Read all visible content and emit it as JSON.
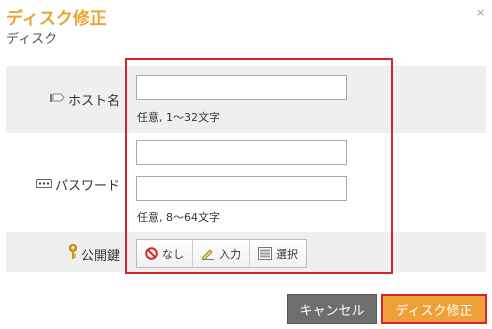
{
  "dialog": {
    "title": "ディスク修正",
    "subtitle": "ディスク",
    "close_symbol": "×"
  },
  "form": {
    "host": {
      "label": "ホスト名",
      "icon": "tag-icon",
      "value": "",
      "hint": "任意, 1〜32文字"
    },
    "password": {
      "label": "パスワード",
      "icon": "password-icon",
      "value": "",
      "confirm_value": "",
      "hint": "任意, 8〜64文字"
    },
    "public_key": {
      "label": "公開鍵",
      "icon": "key-icon",
      "options": [
        {
          "label": "なし",
          "icon": "prohibited-icon"
        },
        {
          "label": "入力",
          "icon": "pencil-icon"
        },
        {
          "label": "選択",
          "icon": "list-icon"
        }
      ]
    }
  },
  "buttons": {
    "cancel": "キャンセル",
    "submit": "ディスク修正"
  },
  "colors": {
    "title": "#e8a735",
    "row_shade": "#efefef",
    "highlight_border": "#d9232d",
    "submit_bg": "#f0a038",
    "cancel_bg": "#6e6e6e"
  }
}
